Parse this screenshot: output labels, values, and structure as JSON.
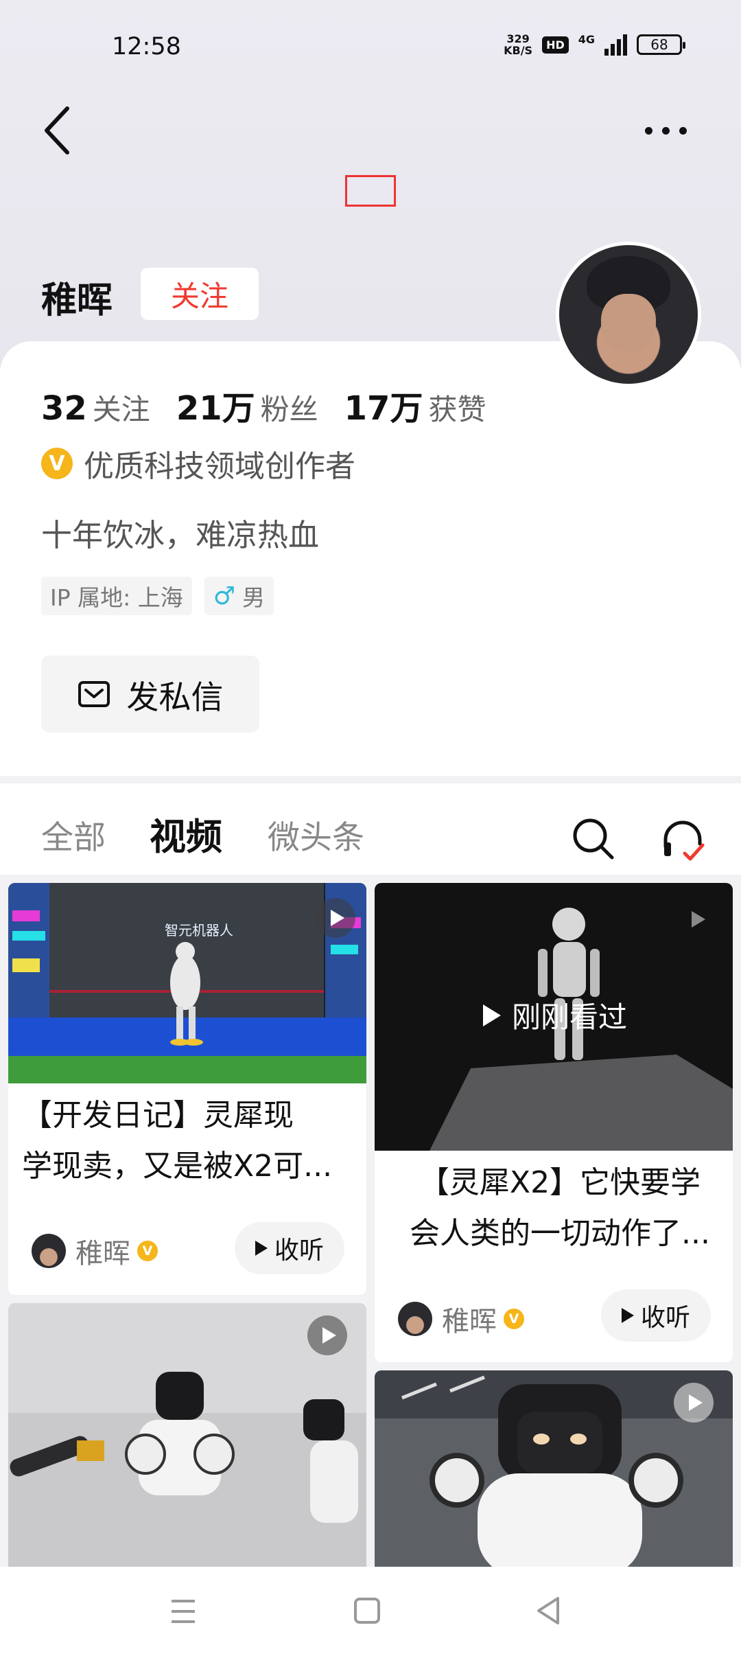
{
  "status_bar": {
    "time": "12:58",
    "net_speed": "329",
    "net_unit": "KB/S",
    "hd": "HD",
    "network": "4G",
    "battery": "68"
  },
  "profile": {
    "name": "稚晖",
    "follow_label": "关注",
    "stats": [
      {
        "value": "32",
        "label": "关注"
      },
      {
        "value": "21万",
        "label": "粉丝"
      },
      {
        "value": "17万",
        "label": "获赞"
      }
    ],
    "verify_badge": "V",
    "verify_text": "优质科技领域创作者",
    "bio": "十年饮冰，难凉热血",
    "ip_tag": "IP 属地: 上海",
    "gender_symbol": "♂",
    "gender": "男",
    "message_label": "发私信"
  },
  "tabs": [
    {
      "label": "全部"
    },
    {
      "label": "视频"
    },
    {
      "label": "微头条"
    }
  ],
  "active_tab": "视频",
  "feed": {
    "cards": [
      {
        "thumb_brand": "智元机器人",
        "title_line1": "【开发日记】灵犀现",
        "title_line2": "学现卖，又是被X2可...",
        "author": "稚晖",
        "verify": "V",
        "listen_label": "收听"
      },
      {
        "overlay": "刚刚看过",
        "title_line1": "【灵犀X2】它快要学",
        "title_line2": "会人类的一切动作了...",
        "author": "稚晖",
        "verify": "V",
        "listen_label": "收听"
      },
      {},
      {}
    ]
  },
  "colors": {
    "accent_red": "#f03a2f",
    "verify_gold": "#f5b51b",
    "male_blue": "#2fb8d8"
  },
  "icons": [
    "back-icon",
    "more-icon",
    "search-icon",
    "headphones-icon",
    "mail-icon",
    "menu-icon",
    "home-square-icon",
    "nav-back-icon",
    "play-icon"
  ]
}
